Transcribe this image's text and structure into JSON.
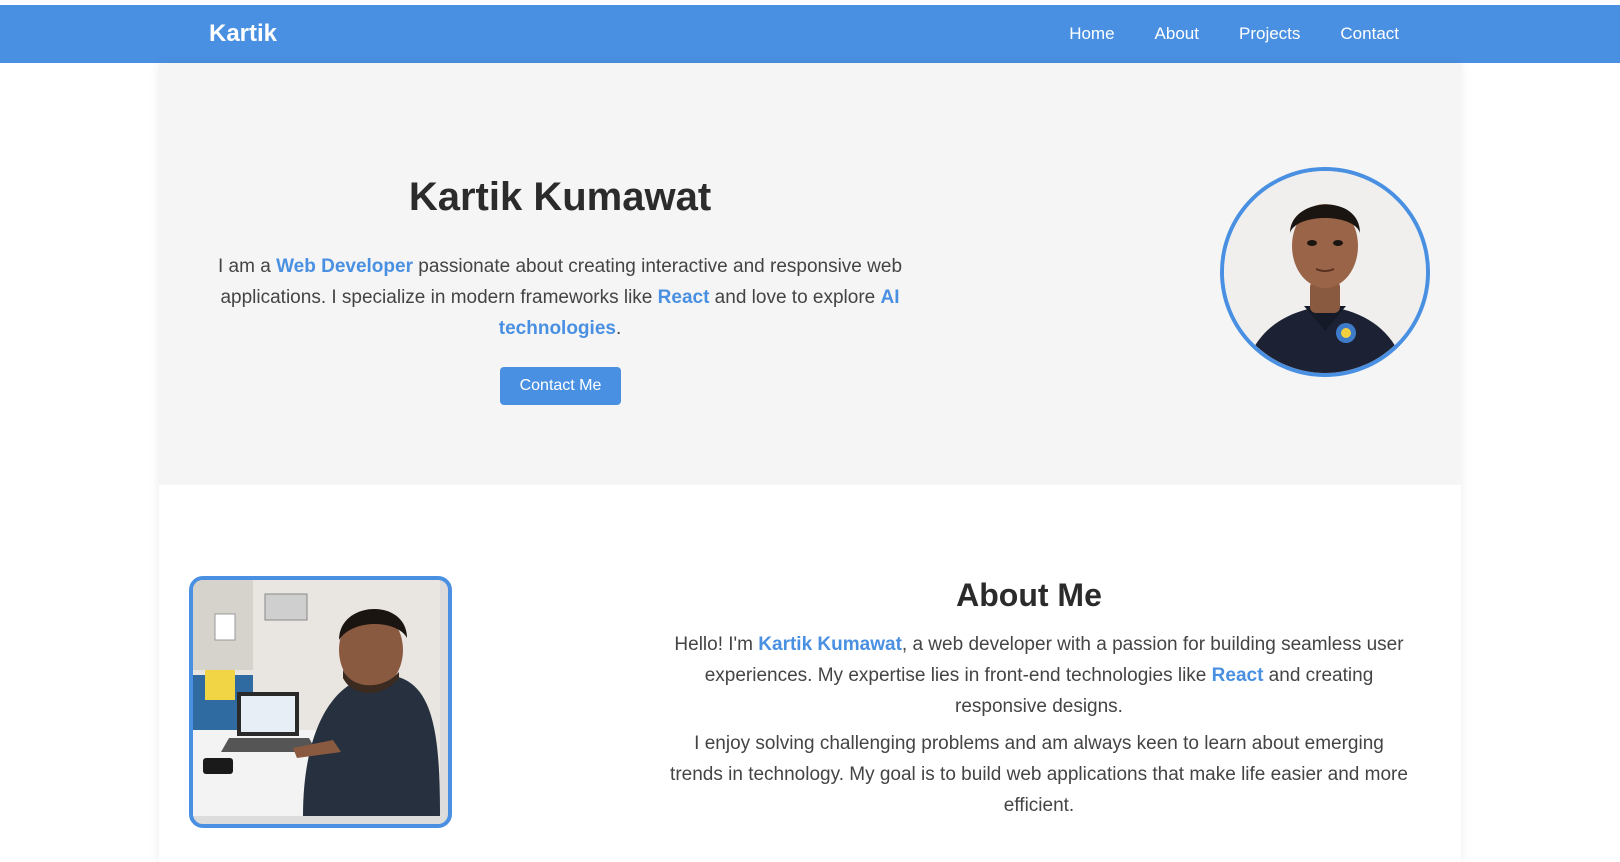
{
  "nav": {
    "brand": "Kartik",
    "links": [
      "Home",
      "About",
      "Projects",
      "Contact"
    ]
  },
  "hero": {
    "title": "Kartik Kumawat",
    "intro": {
      "t1": "I am a ",
      "h1": "Web Developer",
      "t2": " passionate about creating interactive and responsive web applications. I specialize in modern frameworks like ",
      "h2": "React",
      "t3": " and love to explore ",
      "h3": "AI technologies",
      "t4": "."
    },
    "button_label": "Contact Me",
    "avatar_alt": "profile-photo"
  },
  "about": {
    "title": "About Me",
    "p1": {
      "t1": "Hello! I'm ",
      "h1": "Kartik Kumawat",
      "t2": ", a web developer with a passion for building seamless user experiences. My expertise lies in front-end technologies like ",
      "h2": "React",
      "t3": " and creating responsive designs."
    },
    "p2": "I enjoy solving challenging problems and am always keen to learn about emerging trends in technology. My goal is to build web applications that make life easier and more efficient."
  },
  "colors": {
    "accent": "#4a90e2",
    "hero_bg": "#f5f5f5",
    "text": "#444444"
  }
}
